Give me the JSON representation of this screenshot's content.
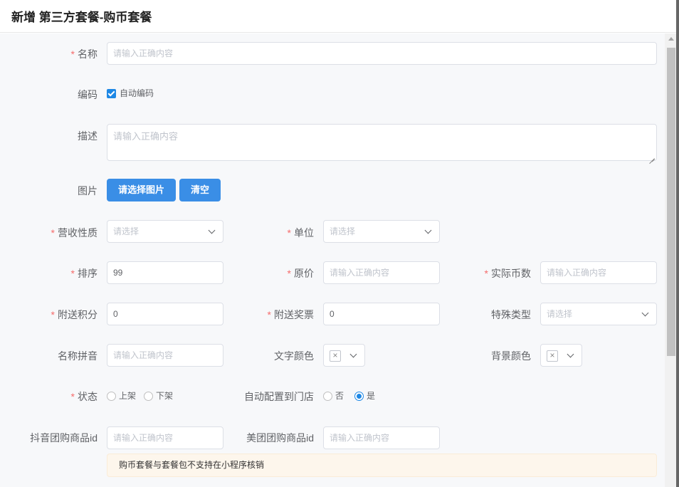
{
  "dialog": {
    "title": "新增 第三方套餐-购币套餐"
  },
  "form": {
    "name": {
      "label": "名称",
      "placeholder": "请输入正确内容"
    },
    "code": {
      "label": "编码",
      "checkbox_label": "自动编码",
      "checked": true
    },
    "description": {
      "label": "描述",
      "placeholder": "请输入正确内容"
    },
    "image": {
      "label": "图片",
      "select_button": "请选择图片",
      "clear_button": "清空"
    },
    "revenue_type": {
      "label": "营收性质",
      "placeholder": "请选择"
    },
    "unit": {
      "label": "单位",
      "placeholder": "请选择"
    },
    "sort": {
      "label": "排序",
      "value": "99"
    },
    "original_price": {
      "label": "原价",
      "placeholder": "请输入正确内容"
    },
    "actual_coins": {
      "label": "实际币数",
      "placeholder": "请输入正确内容"
    },
    "bonus_points": {
      "label": "附送积分",
      "value": "0"
    },
    "bonus_tickets": {
      "label": "附送奖票",
      "value": "0"
    },
    "special_type": {
      "label": "特殊类型",
      "placeholder": "请选择"
    },
    "name_pinyin": {
      "label": "名称拼音",
      "placeholder": "请输入正确内容"
    },
    "text_color": {
      "label": "文字颜色",
      "swatch": "×"
    },
    "bg_color": {
      "label": "背景颜色",
      "swatch": "×"
    },
    "status": {
      "label": "状态",
      "options": [
        "上架",
        "下架"
      ]
    },
    "auto_store": {
      "label": "自动配置到门店",
      "options": [
        "否",
        "是"
      ],
      "selected": "是"
    },
    "douyin_id": {
      "label": "抖音团购商品id",
      "placeholder": "请输入正确内容"
    },
    "meituan_id": {
      "label": "美团团购商品id",
      "placeholder": "请输入正确内容"
    },
    "notice": "购币套餐与套餐包不支持在小程序核销"
  },
  "colors": {
    "primary": "#3a8ee6",
    "required": "#f56c6c",
    "warning_bg": "#fdf6ec"
  }
}
